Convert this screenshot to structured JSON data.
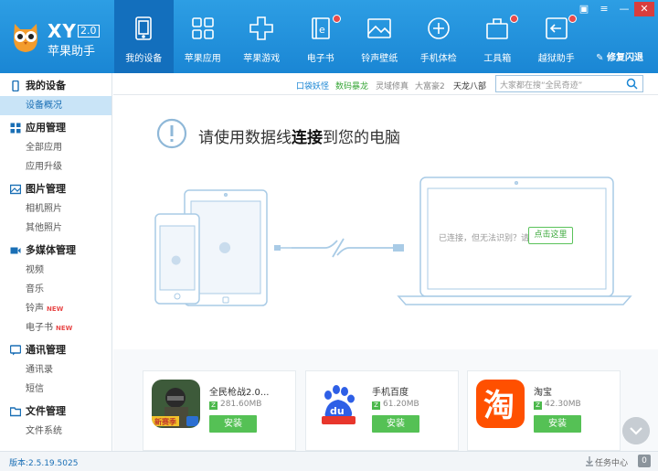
{
  "app": {
    "name": "XY",
    "version_badge": "2.0",
    "subtitle": "苹果助手"
  },
  "nav": [
    {
      "label": "我的设备",
      "icon": "device-icon",
      "active": true,
      "dot": false
    },
    {
      "label": "苹果应用",
      "icon": "apps-grid-icon",
      "active": false,
      "dot": false
    },
    {
      "label": "苹果游戏",
      "icon": "gamepad-icon",
      "active": false,
      "dot": false
    },
    {
      "label": "电子书",
      "icon": "ebook-icon",
      "active": false,
      "dot": true
    },
    {
      "label": "铃声壁纸",
      "icon": "wallpaper-icon",
      "active": false,
      "dot": false
    },
    {
      "label": "手机体检",
      "icon": "checkup-icon",
      "active": false,
      "dot": false
    },
    {
      "label": "工具箱",
      "icon": "toolbox-icon",
      "active": false,
      "dot": true
    },
    {
      "label": "越狱助手",
      "icon": "jailbreak-icon",
      "active": false,
      "dot": true
    }
  ],
  "window": {
    "repair_label": "修复闪退"
  },
  "sidebar": {
    "groups": [
      {
        "label": "我的设备",
        "icon": "phone-icon",
        "items": [
          {
            "label": "设备概况",
            "active": true,
            "badge": ""
          }
        ]
      },
      {
        "label": "应用管理",
        "icon": "grid-icon",
        "items": [
          {
            "label": "全部应用",
            "badge": ""
          },
          {
            "label": "应用升级",
            "badge": ""
          }
        ]
      },
      {
        "label": "图片管理",
        "icon": "picture-icon",
        "items": [
          {
            "label": "相机照片",
            "badge": ""
          },
          {
            "label": "其他照片",
            "badge": ""
          }
        ]
      },
      {
        "label": "多媒体管理",
        "icon": "video-icon",
        "items": [
          {
            "label": "视频",
            "badge": ""
          },
          {
            "label": "音乐",
            "badge": ""
          },
          {
            "label": "铃声",
            "badge": "NEW"
          },
          {
            "label": "电子书",
            "badge": "NEW"
          }
        ]
      },
      {
        "label": "通讯管理",
        "icon": "chat-icon",
        "items": [
          {
            "label": "通讯录",
            "badge": ""
          },
          {
            "label": "短信",
            "badge": ""
          }
        ]
      },
      {
        "label": "文件管理",
        "icon": "folder-icon",
        "items": [
          {
            "label": "文件系统",
            "badge": ""
          }
        ]
      }
    ]
  },
  "quick_tabs": [
    {
      "label": "口袋妖怪",
      "color": "#1a86d4"
    },
    {
      "label": "数码暴龙",
      "color": "#3aa83a"
    },
    {
      "label": "灵域修真",
      "color": "#888888"
    },
    {
      "label": "大富豪2",
      "color": "#888888"
    },
    {
      "label": "天龙八部",
      "color": "#333333"
    }
  ],
  "search": {
    "placeholder": "大家都在搜“全民奇迹”"
  },
  "hero": {
    "msg_before": "请使用数据线",
    "msg_bold": "连接",
    "msg_after": "到您的电脑",
    "laptop_msg": "已连接，但无法识别？请",
    "fix_button": "点击这里"
  },
  "apps": [
    {
      "name": "全民枪战2.0...",
      "size": "281.60MB",
      "install": "安装",
      "icon": "game-soldier-icon",
      "icon_badge": "新赛季"
    },
    {
      "name": "手机百度",
      "size": "61.20MB",
      "install": "安装",
      "icon": "baidu-icon",
      "icon_text": "du"
    },
    {
      "name": "淘宝",
      "size": "42.30MB",
      "install": "安装",
      "icon": "taobao-icon",
      "icon_text": "淘"
    }
  ],
  "status": {
    "version": "版本:2.5.19.5025",
    "task_center": "任务中心",
    "task_count": "0"
  },
  "colors": {
    "header": "#1a86d4",
    "active_nav": "#136fbd",
    "accent_green": "#55c155",
    "alert_red": "#e84a4a"
  }
}
